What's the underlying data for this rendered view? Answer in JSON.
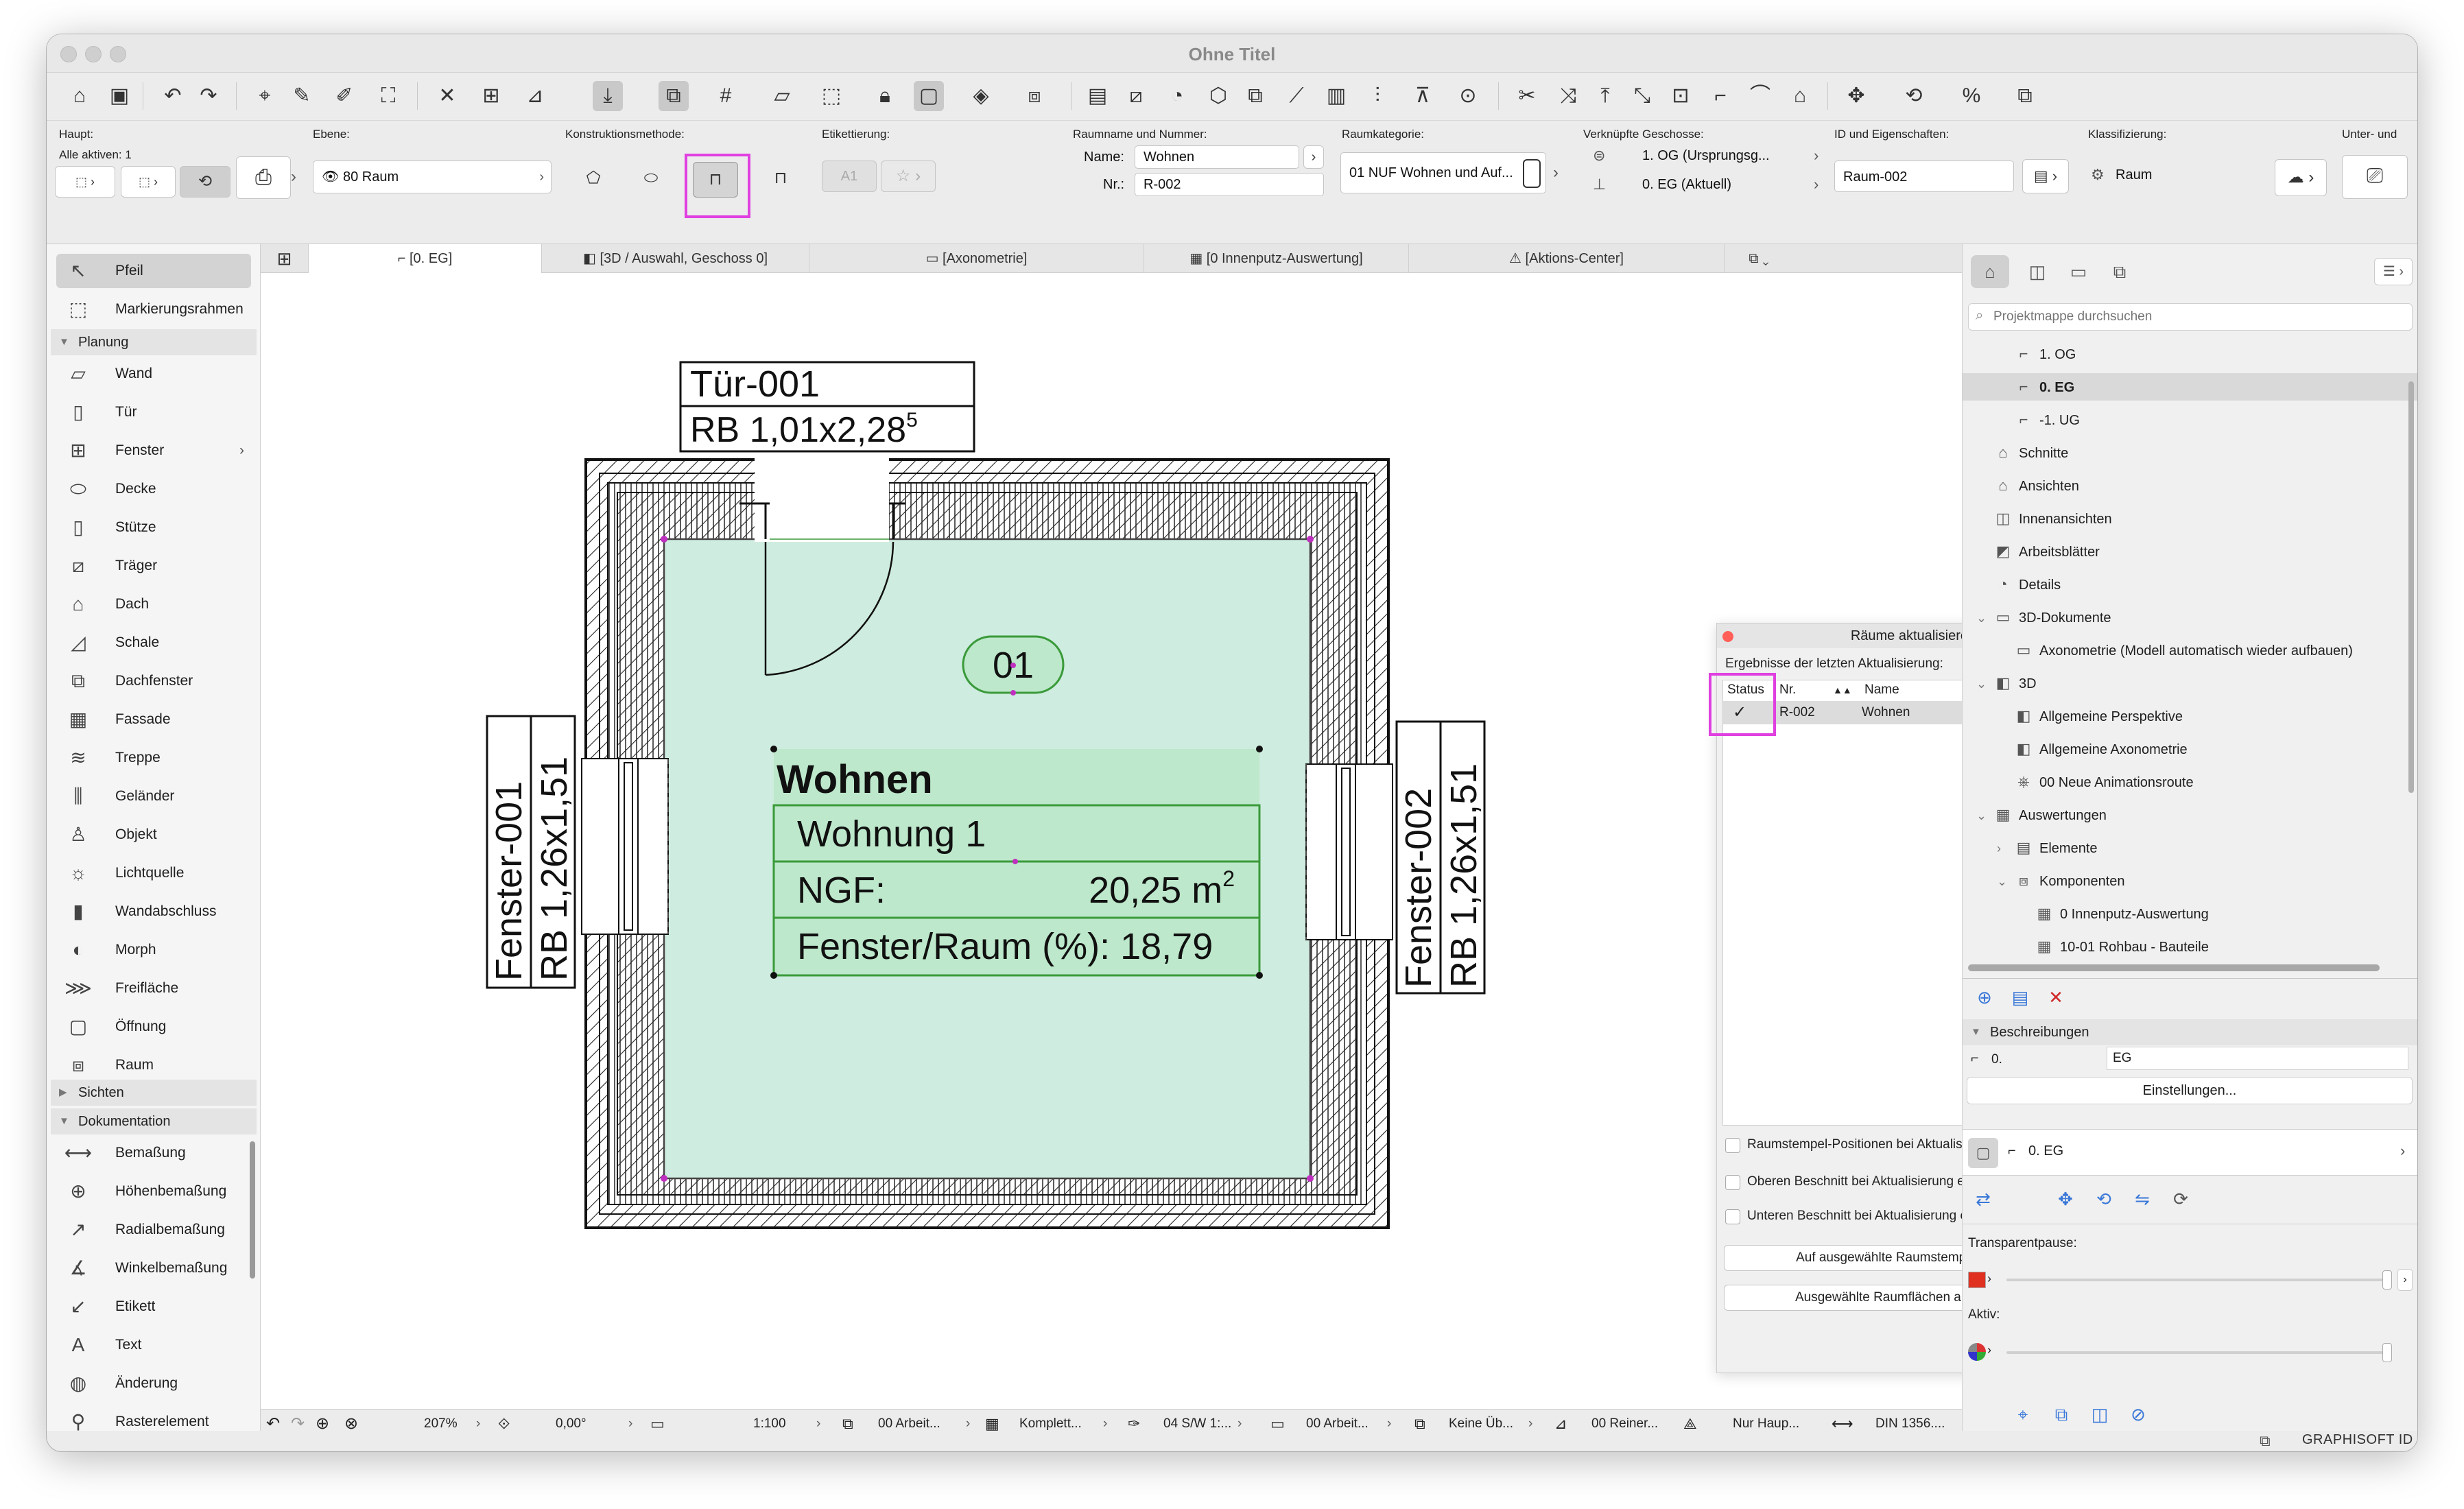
{
  "window": {
    "title": "Ohne Titel"
  },
  "infobox": {
    "haupt_label": "Haupt:",
    "alle_aktiven": "Alle aktiven: 1",
    "ebene_label": "Ebene:",
    "ebene_value": "80 Raum",
    "konstruktion_label": "Konstruktionsmethode:",
    "etikett_label": "Etikettierung:",
    "etikett_value": "A1",
    "raumname_label": "Raumname und Nummer:",
    "name_label": "Name:",
    "name_value": "Wohnen",
    "nr_label": "Nr.:",
    "nr_value": "R-002",
    "raumkategorie_label": "Raumkategorie:",
    "raumkategorie_value": "01 NUF Wohnen und Auf...",
    "geschosse_label": "Verknüpfte Geschosse:",
    "geschoss_oben": "1. OG (Ursprungsg...",
    "geschoss_unten": "0. EG (Aktuell)",
    "id_label": "ID und Eigenschaften:",
    "id_value": "Raum-002",
    "klass_label": "Klassifizierung:",
    "klass_value": "Raum",
    "unter_label": "Unter- und"
  },
  "toolbox": {
    "top": [
      {
        "icon": "arrow-icon",
        "glyph": "↖",
        "label": "Pfeil"
      },
      {
        "icon": "marquee-icon",
        "glyph": "⬚",
        "label": "Markierungsrahmen"
      }
    ],
    "planung_label": "Planung",
    "planung": [
      {
        "icon": "wall-icon",
        "glyph": "▱",
        "label": "Wand"
      },
      {
        "icon": "door-icon",
        "glyph": "▯",
        "label": "Tür"
      },
      {
        "icon": "window-icon",
        "glyph": "⊞",
        "label": "Fenster",
        "more": "›"
      },
      {
        "icon": "slab-icon",
        "glyph": "⬭",
        "label": "Decke"
      },
      {
        "icon": "column-icon",
        "glyph": "▯",
        "label": "Stütze"
      },
      {
        "icon": "beam-icon",
        "glyph": "⧄",
        "label": "Träger"
      },
      {
        "icon": "roof-icon",
        "glyph": "⌂",
        "label": "Dach"
      },
      {
        "icon": "shell-icon",
        "glyph": "◿",
        "label": "Schale"
      },
      {
        "icon": "skylight-icon",
        "glyph": "⧉",
        "label": "Dachfenster"
      },
      {
        "icon": "curtain-wall-icon",
        "glyph": "▦",
        "label": "Fassade"
      },
      {
        "icon": "stair-icon",
        "glyph": "≋",
        "label": "Treppe"
      },
      {
        "icon": "railing-icon",
        "glyph": "⫼",
        "label": "Geländer"
      },
      {
        "icon": "object-icon",
        "glyph": "♙",
        "label": "Objekt"
      },
      {
        "icon": "lamp-icon",
        "glyph": "☼",
        "label": "Lichtquelle"
      },
      {
        "icon": "wall-end-icon",
        "glyph": "▮",
        "label": "Wandabschluss"
      },
      {
        "icon": "morph-icon",
        "glyph": "◐",
        "label": "Morph"
      },
      {
        "icon": "mesh-icon",
        "glyph": "⋙",
        "label": "Freifläche"
      },
      {
        "icon": "opening-icon",
        "glyph": "▢",
        "label": "Öffnung"
      },
      {
        "icon": "zone-icon",
        "glyph": "⧈",
        "label": "Raum"
      }
    ],
    "sichten_label": "Sichten",
    "doku_label": "Dokumentation",
    "doku": [
      {
        "icon": "dimension-icon",
        "glyph": "⟷",
        "label": "Bemaßung"
      },
      {
        "icon": "level-dimension-icon",
        "glyph": "⊕",
        "label": "Höhenbemaßung"
      },
      {
        "icon": "radial-dimension-icon",
        "glyph": "↗",
        "label": "Radialbemaßung"
      },
      {
        "icon": "angle-dimension-icon",
        "glyph": "∡",
        "label": "Winkelbemaßung"
      },
      {
        "icon": "label-icon",
        "glyph": "↙",
        "label": "Etikett"
      },
      {
        "icon": "text-icon",
        "glyph": "A",
        "label": "Text"
      },
      {
        "icon": "change-icon",
        "glyph": "◍",
        "label": "Änderung"
      },
      {
        "icon": "grid-element-icon",
        "glyph": "⚲",
        "label": "Rasterelement"
      }
    ]
  },
  "tabs": [
    "[0. EG]",
    "[3D / Auswahl, Geschoss 0]",
    "[Axonometrie]",
    "[0 Innenputz-Auswertung]",
    "[Aktions-Center]"
  ],
  "plan": {
    "door_id": "Tür-001",
    "door_size": "RB  1,01x2,28",
    "door_size_sup": "5",
    "win1_id": "Fenster-001",
    "win1_size": "RB  1,26x1,51",
    "win2_id": "Fenster-002",
    "win2_size": "RB  1,26x1,51",
    "zone_number": "01",
    "zone_name": "Wohnen",
    "zone_unit": "Wohnung 1",
    "ngf_label": "NGF:",
    "ngf_value": "20,25 m",
    "ngf_sup": "2",
    "ratio": "Fenster/Raum (%): 18,79",
    "zone_fill": "#ceecdf",
    "stamp_fill": "#bde8cb",
    "stamp_line": "#3a9a3a"
  },
  "dialog": {
    "title": "Räume aktualisieren",
    "subtitle": "Ergebnisse der letzten Aktualisierung:",
    "col_status": "Status",
    "col_nr": "Nr.",
    "col_name": "Name",
    "row": {
      "status": "✓",
      "nr": "R-002",
      "name": "Wohnen"
    },
    "opt1": "Raumstempel-Positionen bei Aktualisierung behalten",
    "opt2": "Oberen Beschnitt bei Aktualisierung entfernen",
    "opt3": "Unteren Beschnitt bei Aktualisierung entfernen",
    "btn_zoom": "Auf ausgewählte Raumstempel zoomen",
    "btn_update": "Ausgewählte Raumflächen aktualisieren"
  },
  "navigator": {
    "search_placeholder": "Projektmappe durchsuchen",
    "items": [
      {
        "label": "1. OG",
        "indent": 1,
        "glyph": "⌐",
        "icon": "story-icon"
      },
      {
        "label": "0. EG",
        "indent": 1,
        "glyph": "⌐",
        "icon": "story-icon",
        "selected": true
      },
      {
        "label": "-1. UG",
        "indent": 1,
        "glyph": "⌐",
        "icon": "story-icon"
      },
      {
        "label": "Schnitte",
        "indent": 0,
        "glyph": "⌂",
        "icon": "section-icon"
      },
      {
        "label": "Ansichten",
        "indent": 0,
        "glyph": "⌂",
        "icon": "elevation-icon"
      },
      {
        "label": "Innenansichten",
        "indent": 0,
        "glyph": "◫",
        "icon": "interior-elevation-icon"
      },
      {
        "label": "Arbeitsblätter",
        "indent": 0,
        "glyph": "◩",
        "icon": "worksheet-icon"
      },
      {
        "label": "Details",
        "indent": 0,
        "glyph": "◔",
        "icon": "detail-icon"
      },
      {
        "label": "3D-Dokumente",
        "indent": 0,
        "glyph": "▭",
        "icon": "3d-document-icon",
        "arrow": "⌄"
      },
      {
        "label": "Axonometrie (Modell automatisch wieder aufbauen)",
        "indent": 1,
        "glyph": "▭",
        "icon": "3d-document-icon"
      },
      {
        "label": "3D",
        "indent": 0,
        "glyph": "◧",
        "icon": "3d-icon",
        "arrow": "⌄"
      },
      {
        "label": "Allgemeine Perspektive",
        "indent": 1,
        "glyph": "◧",
        "icon": "perspective-icon"
      },
      {
        "label": "Allgemeine Axonometrie",
        "indent": 1,
        "glyph": "◧",
        "icon": "axonometry-icon"
      },
      {
        "label": "00 Neue Animationsroute",
        "indent": 1,
        "glyph": "⎈",
        "icon": "camera-path-icon"
      },
      {
        "label": "Auswertungen",
        "indent": 0,
        "glyph": "▦",
        "icon": "schedule-icon",
        "arrow": "⌄"
      },
      {
        "label": "Elemente",
        "indent": 1,
        "glyph": "▤",
        "icon": "elements-icon",
        "arrow": "›"
      },
      {
        "label": "Komponenten",
        "indent": 1,
        "glyph": "⧈",
        "icon": "components-icon",
        "arrow": "⌄"
      },
      {
        "label": "0 Innenputz-Auswertung",
        "indent": 2,
        "glyph": "▦",
        "icon": "schedule-icon"
      },
      {
        "label": "10-01 Rohbau - Bauteile",
        "indent": 2,
        "glyph": "▦",
        "icon": "schedule-icon"
      }
    ],
    "beschreibungen": "Beschreibungen",
    "desc_key": "0.",
    "desc_value": "EG",
    "settings_btn": "Einstellungen...",
    "current_story": "0. EG",
    "transparent_label": "Transparentpause:",
    "aktiv_label": "Aktiv:",
    "trace_color": "#e03020"
  },
  "statusbar": {
    "zoom": "207%",
    "angle": "0,00°",
    "scale": "1:100",
    "layer_combo": "00 Arbeit...",
    "model_view": "Komplett...",
    "pen_set": "04 S/W 1:...",
    "display": "00 Arbeit...",
    "overrides": "Keine Üb...",
    "renovation": "00 Reiner...",
    "structure": "Nur Haup...",
    "dimension": "DIN 1356...."
  },
  "footer": {
    "brand": "GRAPHISOFT ID"
  }
}
